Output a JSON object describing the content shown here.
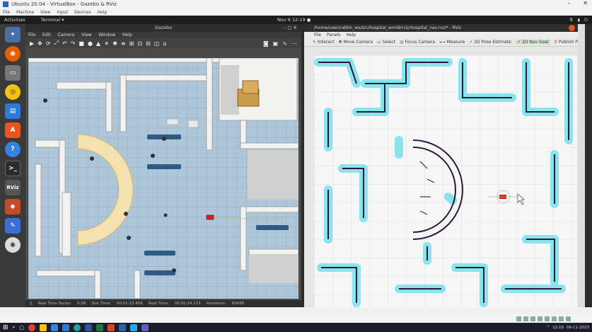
{
  "host": {
    "title": "Ubuntu 20.04 - VirtualBox - Gazebo & RViz",
    "menu": [
      "File",
      "Machine",
      "View",
      "Input",
      "Devices",
      "Help"
    ]
  },
  "ubuntu_bar": {
    "activities": "Activities",
    "app": "Terminal ▾",
    "clock": "Nov 6 12:19 ●"
  },
  "dock": [
    "ubuntu",
    "firefox",
    "files",
    "rhythmbox",
    "writer",
    "software",
    "help",
    "terminal",
    "rviz",
    "layers",
    "editor",
    "disc"
  ],
  "gazebo": {
    "title": "Gazebo",
    "menu": [
      "File",
      "Edit",
      "Camera",
      "View",
      "Window",
      "Help"
    ],
    "toolbar": [
      "▶",
      "✥",
      "⟳",
      "⤢",
      "↶",
      "↷",
      "■",
      "●",
      "▲",
      "☀",
      "✺",
      "≡",
      "⊞",
      "⊡",
      "⊟",
      "◫",
      "⌂",
      "Ω"
    ],
    "status": [
      "||",
      "Real Time Factor:",
      "0.98",
      "Sim Time:",
      "00:01:23.456",
      "Real Time:",
      "00:01:24.123",
      "Iterations:",
      "83456"
    ]
  },
  "rviz": {
    "title": "/home/user/catkin_ws/src/hospital_world/rviz/hospital_nav.rviz* - RViz",
    "menu": [
      "File",
      "Panels",
      "Help"
    ],
    "toolbar": [
      "Interact",
      "Move Camera",
      "Select",
      "Focus Camera",
      "Measure",
      "2D Pose Estimate",
      "2D Nav Goal",
      "Publish Point",
      "+"
    ]
  },
  "taskbar": {
    "time": "12:19",
    "date": "06-11-2023"
  }
}
